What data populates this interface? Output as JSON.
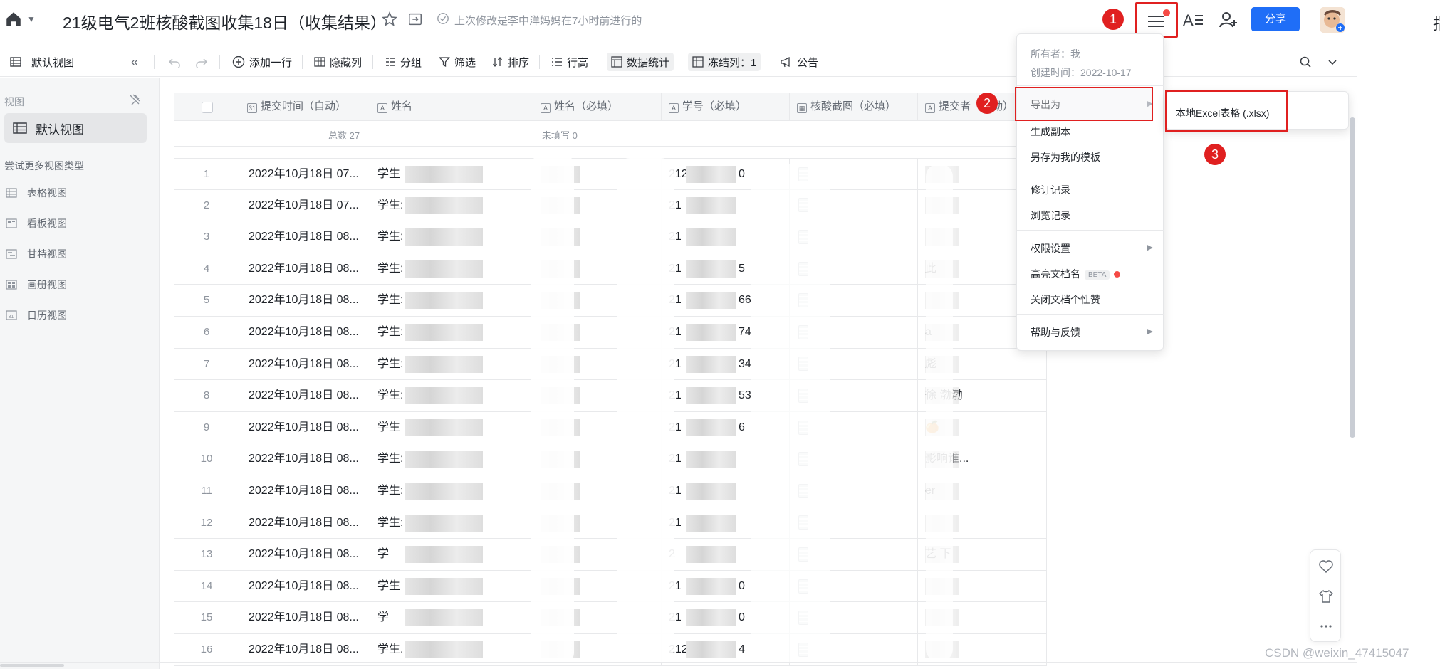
{
  "app": {
    "title": "21级电气2班核酸截图收集18日（收集结果）",
    "last_modified": "上次修改是李中洋妈妈在7小时前进行的",
    "share_label": "分享",
    "edge_text": "指",
    "watermark": "CSDN @weixin_47415047"
  },
  "toolbar": {
    "view_name": "默认视图",
    "add_row": "添加一行",
    "hide_cols": "隐藏列",
    "group": "分组",
    "filter": "筛选",
    "sort": "排序",
    "row_height": "行高",
    "stats": "数据统计",
    "freeze": "冻结列：1",
    "notice": "公告"
  },
  "sidebar": {
    "header": "视图",
    "default_view": "默认视图",
    "more_types": "尝试更多视图类型",
    "items": [
      {
        "label": "表格视图",
        "icon": "grid-icon"
      },
      {
        "label": "看板视图",
        "icon": "kanban-icon"
      },
      {
        "label": "甘特视图",
        "icon": "gantt-icon"
      },
      {
        "label": "画册视图",
        "icon": "gallery-icon"
      },
      {
        "label": "日历视图",
        "icon": "calendar-icon"
      }
    ]
  },
  "table": {
    "headers": [
      "提交时间（自动）",
      "姓名",
      "姓名（必填）",
      "学号（必填）",
      "核酸截图（必填）",
      "提交者（自动）"
    ],
    "header_icons": [
      "31",
      "A",
      "A",
      "A",
      "img",
      "A"
    ],
    "summary_total": "总数 27",
    "summary_unfilled": "未填写 0",
    "rows": [
      {
        "no": "1",
        "time": "2022年10月18日 07...",
        "name": "学生",
        "sid": "2120",
        "sid_tail": "0",
        "submitter": ""
      },
      {
        "no": "2",
        "time": "2022年10月18日 07...",
        "name": "学生:",
        "sid": "21",
        "sid_tail": "",
        "submitter": ""
      },
      {
        "no": "3",
        "time": "2022年10月18日 08...",
        "name": "学生:",
        "sid": "21",
        "sid_tail": "",
        "submitter": ""
      },
      {
        "no": "4",
        "time": "2022年10月18日 08...",
        "name": "学生:",
        "sid": "21",
        "sid_tail": "5",
        "submitter": "此"
      },
      {
        "no": "5",
        "time": "2022年10月18日 08...",
        "name": "学生:",
        "sid": "21",
        "sid_tail": "66",
        "submitter": ""
      },
      {
        "no": "6",
        "time": "2022年10月18日 08...",
        "name": "学生:",
        "sid": "21",
        "sid_tail": "74",
        "submitter": "a"
      },
      {
        "no": "7",
        "time": "2022年10月18日 08...",
        "name": "学生:",
        "sid": "21",
        "sid_tail": "34",
        "submitter": "彪"
      },
      {
        "no": "8",
        "time": "2022年10月18日 08...",
        "name": "学生:",
        "sid": "21",
        "sid_tail": "53",
        "submitter": "徐    渤渤"
      },
      {
        "no": "9",
        "time": "2022年10月18日 08...",
        "name": "学生",
        "sid": "21",
        "sid_tail": "6",
        "submitter": "🍊"
      },
      {
        "no": "10",
        "time": "2022年10月18日 08...",
        "name": "学生: 李",
        "sid": "21",
        "sid_tail": "",
        "submitter": "       影响谁..."
      },
      {
        "no": "11",
        "time": "2022年10月18日 08...",
        "name": "学生:",
        "sid": "21",
        "sid_tail": "",
        "submitter": "er"
      },
      {
        "no": "12",
        "time": "2022年10月18日 08...",
        "name": "学生:",
        "sid": "21",
        "sid_tail": "",
        "submitter": ""
      },
      {
        "no": "13",
        "time": "2022年10月18日 08...",
        "name": "学",
        "sid": "2",
        "sid_tail": "",
        "submitter": "    艺    下"
      },
      {
        "no": "14",
        "time": "2022年10月18日 08...",
        "name": "学生",
        "sid": "21",
        "sid_tail": "0",
        "submitter": ""
      },
      {
        "no": "15",
        "time": "2022年10月18日 08...",
        "name": "学",
        "sid": "21",
        "sid_tail": "0",
        "submitter": ""
      },
      {
        "no": "16",
        "time": "2022年10月18日 08...",
        "name": "学生.",
        "sid": "21208",
        "sid_tail": "4",
        "submitter": ""
      }
    ]
  },
  "menu": {
    "owner": "所有者：我",
    "created": "创建时间：2022-10-17",
    "export": "导出为",
    "copy": "生成副本",
    "save_template": "另存为我的模板",
    "revisions": "修订记录",
    "browse_history": "浏览记录",
    "permissions": "权限设置",
    "highlight_name": "高亮文档名",
    "beta": "BETA",
    "disable_likes": "关闭文档个性赞",
    "help": "帮助与反馈"
  },
  "submenu": {
    "excel": "本地Excel表格 (.xlsx)"
  },
  "steps": [
    "1",
    "2",
    "3"
  ],
  "colors": {
    "accent": "#1f6ef7",
    "annotation_red": "#e02020",
    "dot_red": "#f54a45"
  }
}
